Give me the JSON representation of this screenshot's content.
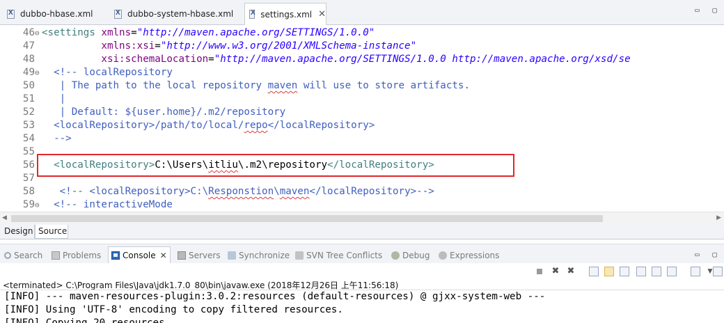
{
  "editor_tabs": [
    {
      "label": "dubbo-hbase.xml"
    },
    {
      "label": "dubbo-system-hbase.xml"
    },
    {
      "label": "settings.xml",
      "close": "✕"
    }
  ],
  "editor_minmax": "▭ ▢",
  "code_lines": [
    {
      "ln": "46",
      "fold": "⊖",
      "tokens": [
        {
          "k": "t",
          "s": "<settings "
        },
        {
          "k": "a",
          "s": "xmlns"
        },
        {
          "k": "x",
          "s": "="
        },
        {
          "k": "v",
          "s": "\"http://maven.apache.org/SETTINGS/1.0.0\""
        }
      ]
    },
    {
      "ln": "47",
      "tokens": [
        {
          "k": "x",
          "s": "          "
        },
        {
          "k": "a",
          "s": "xmlns:xsi"
        },
        {
          "k": "x",
          "s": "="
        },
        {
          "k": "v",
          "s": "\"http://www.w3.org/2001/XMLSchema-instance\""
        }
      ]
    },
    {
      "ln": "48",
      "tokens": [
        {
          "k": "x",
          "s": "          "
        },
        {
          "k": "a",
          "s": "xsi:schemaLocation"
        },
        {
          "k": "x",
          "s": "="
        },
        {
          "k": "v",
          "s": "\"http://maven.apache.org/SETTINGS/1.0.0 http://maven.apache.org/xsd/se"
        }
      ]
    },
    {
      "ln": "49",
      "fold": "⊖",
      "tokens": [
        {
          "k": "c",
          "s": "  <!-- localRepository"
        }
      ]
    },
    {
      "ln": "50",
      "tokens": [
        {
          "k": "c",
          "s": "   | The path to the local repository "
        },
        {
          "k": "c",
          "s": "maven",
          "sq": true
        },
        {
          "k": "c",
          "s": " will use to store artifacts."
        }
      ]
    },
    {
      "ln": "51",
      "tokens": [
        {
          "k": "c",
          "s": "   |"
        }
      ]
    },
    {
      "ln": "52",
      "tokens": [
        {
          "k": "c",
          "s": "   | Default: ${user.home}/.m2/repository"
        }
      ]
    },
    {
      "ln": "53",
      "tokens": [
        {
          "k": "c",
          "s": "  <localRepository>/path/to/local/"
        },
        {
          "k": "c",
          "s": "repo",
          "sq": true
        },
        {
          "k": "c",
          "s": "</localRepository>"
        }
      ]
    },
    {
      "ln": "54",
      "tokens": [
        {
          "k": "c",
          "s": "  -->"
        }
      ]
    },
    {
      "ln": "55",
      "tokens": []
    },
    {
      "ln": "56",
      "tokens": [
        {
          "k": "x",
          "s": "  "
        },
        {
          "k": "t",
          "s": "<localRepository>"
        },
        {
          "k": "x",
          "s": "C:\\Users\\"
        },
        {
          "k": "x",
          "s": "itliu",
          "sq": true
        },
        {
          "k": "x",
          "s": "\\.m2\\repository"
        },
        {
          "k": "t",
          "s": "</localRepository>"
        }
      ]
    },
    {
      "ln": "57",
      "tokens": []
    },
    {
      "ln": "58",
      "tokens": [
        {
          "k": "c",
          "s": "   <!-- <localRepository>C:\\"
        },
        {
          "k": "c",
          "s": "Responstion",
          "sq": true
        },
        {
          "k": "c",
          "s": "\\"
        },
        {
          "k": "c",
          "s": "maven",
          "sq": true
        },
        {
          "k": "c",
          "s": "</localRepository>-->"
        }
      ]
    },
    {
      "ln": "59",
      "fold": "⊖",
      "tokens": [
        {
          "k": "c",
          "s": "  <!-- interactiveMode"
        }
      ]
    }
  ],
  "design_tab": "Design",
  "source_tab": "Source",
  "view_tabs": [
    {
      "label": "Search",
      "icon": "search-icon"
    },
    {
      "label": "Problems",
      "icon": "problems-icon"
    },
    {
      "label": "Console",
      "icon": "console-icon",
      "close": "✕"
    },
    {
      "label": "Servers",
      "icon": "servers-icon"
    },
    {
      "label": "Synchronize",
      "icon": "synchronize-icon"
    },
    {
      "label": "SVN Tree Conflicts",
      "icon": "svn-tree-conflicts-icon"
    },
    {
      "label": "Debug",
      "icon": "debug-icon"
    },
    {
      "label": "Expressions",
      "icon": "expressions-icon"
    }
  ],
  "view_minmax": "▭ ▢",
  "console": {
    "status": "<terminated> C:\\Program Files\\Java\\jdk1.7.0_80\\bin\\javaw.exe (2018年12月26日 上午11:56:18)",
    "lines": [
      "[INFO] --- maven-resources-plugin:3.0.2:resources (default-resources) @ gjxx-system-web ---",
      "[INFO] Using 'UTF-8' encoding to copy filtered resources.",
      "[INFO] Copying 20 resources"
    ]
  },
  "colors": {
    "tag": "#3f7f7f",
    "attribute": "#7f007f",
    "value": "#2a00ff",
    "comment": "#3f5fbf",
    "highlight_box": "#e0272b"
  }
}
